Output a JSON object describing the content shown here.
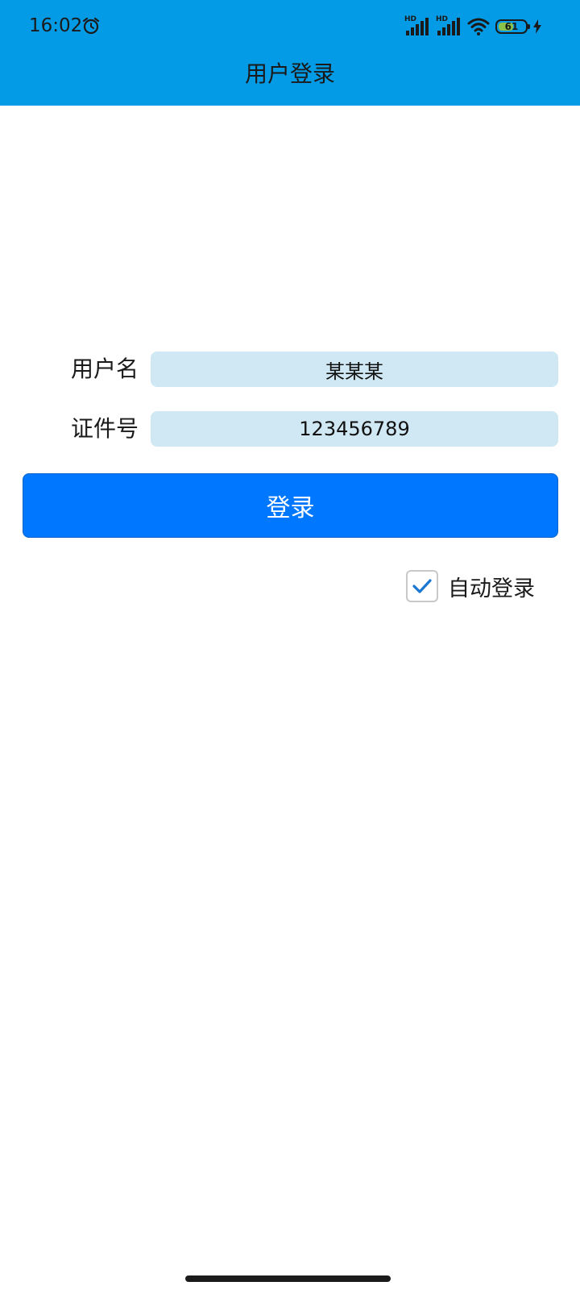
{
  "status_bar": {
    "time": "16:02",
    "signal_badge": "HD",
    "battery_level": "61",
    "battery_percent": 61,
    "icons": [
      "alarm-icon",
      "signal-icon",
      "signal-icon",
      "wifi-icon",
      "battery-icon",
      "charging-bolt-icon"
    ]
  },
  "header": {
    "title": "用户登录"
  },
  "form": {
    "username_label": "用户名",
    "username_value": "某某某",
    "id_label": "证件号",
    "id_value": "123456789",
    "login_label": "登录",
    "auto_login_label": "自动登录",
    "auto_login_checked": true
  },
  "colors": {
    "header_bg": "#039be5",
    "field_bg": "#cfe8f3",
    "button_bg": "#0077ff",
    "check_mark": "#1976d2"
  }
}
